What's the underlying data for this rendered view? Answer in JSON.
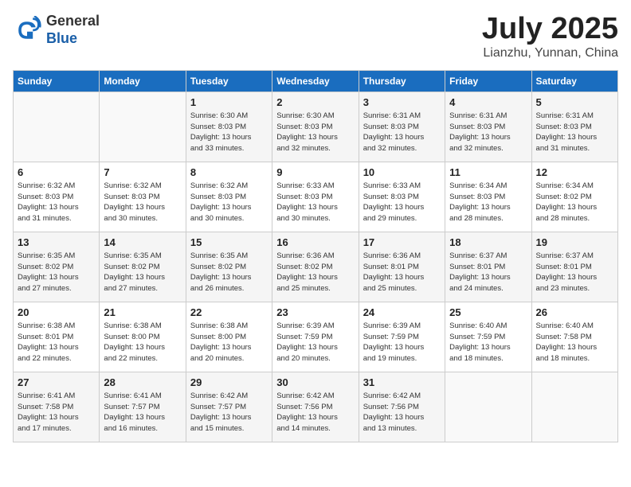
{
  "header": {
    "logo_line1": "General",
    "logo_line2": "Blue",
    "title": "July 2025",
    "subtitle": "Lianzhu, Yunnan, China"
  },
  "weekdays": [
    "Sunday",
    "Monday",
    "Tuesday",
    "Wednesday",
    "Thursday",
    "Friday",
    "Saturday"
  ],
  "weeks": [
    [
      {
        "day": "",
        "info": ""
      },
      {
        "day": "",
        "info": ""
      },
      {
        "day": "1",
        "info": "Sunrise: 6:30 AM\nSunset: 8:03 PM\nDaylight: 13 hours\nand 33 minutes."
      },
      {
        "day": "2",
        "info": "Sunrise: 6:30 AM\nSunset: 8:03 PM\nDaylight: 13 hours\nand 32 minutes."
      },
      {
        "day": "3",
        "info": "Sunrise: 6:31 AM\nSunset: 8:03 PM\nDaylight: 13 hours\nand 32 minutes."
      },
      {
        "day": "4",
        "info": "Sunrise: 6:31 AM\nSunset: 8:03 PM\nDaylight: 13 hours\nand 32 minutes."
      },
      {
        "day": "5",
        "info": "Sunrise: 6:31 AM\nSunset: 8:03 PM\nDaylight: 13 hours\nand 31 minutes."
      }
    ],
    [
      {
        "day": "6",
        "info": "Sunrise: 6:32 AM\nSunset: 8:03 PM\nDaylight: 13 hours\nand 31 minutes."
      },
      {
        "day": "7",
        "info": "Sunrise: 6:32 AM\nSunset: 8:03 PM\nDaylight: 13 hours\nand 30 minutes."
      },
      {
        "day": "8",
        "info": "Sunrise: 6:32 AM\nSunset: 8:03 PM\nDaylight: 13 hours\nand 30 minutes."
      },
      {
        "day": "9",
        "info": "Sunrise: 6:33 AM\nSunset: 8:03 PM\nDaylight: 13 hours\nand 30 minutes."
      },
      {
        "day": "10",
        "info": "Sunrise: 6:33 AM\nSunset: 8:03 PM\nDaylight: 13 hours\nand 29 minutes."
      },
      {
        "day": "11",
        "info": "Sunrise: 6:34 AM\nSunset: 8:03 PM\nDaylight: 13 hours\nand 28 minutes."
      },
      {
        "day": "12",
        "info": "Sunrise: 6:34 AM\nSunset: 8:02 PM\nDaylight: 13 hours\nand 28 minutes."
      }
    ],
    [
      {
        "day": "13",
        "info": "Sunrise: 6:35 AM\nSunset: 8:02 PM\nDaylight: 13 hours\nand 27 minutes."
      },
      {
        "day": "14",
        "info": "Sunrise: 6:35 AM\nSunset: 8:02 PM\nDaylight: 13 hours\nand 27 minutes."
      },
      {
        "day": "15",
        "info": "Sunrise: 6:35 AM\nSunset: 8:02 PM\nDaylight: 13 hours\nand 26 minutes."
      },
      {
        "day": "16",
        "info": "Sunrise: 6:36 AM\nSunset: 8:02 PM\nDaylight: 13 hours\nand 25 minutes."
      },
      {
        "day": "17",
        "info": "Sunrise: 6:36 AM\nSunset: 8:01 PM\nDaylight: 13 hours\nand 25 minutes."
      },
      {
        "day": "18",
        "info": "Sunrise: 6:37 AM\nSunset: 8:01 PM\nDaylight: 13 hours\nand 24 minutes."
      },
      {
        "day": "19",
        "info": "Sunrise: 6:37 AM\nSunset: 8:01 PM\nDaylight: 13 hours\nand 23 minutes."
      }
    ],
    [
      {
        "day": "20",
        "info": "Sunrise: 6:38 AM\nSunset: 8:01 PM\nDaylight: 13 hours\nand 22 minutes."
      },
      {
        "day": "21",
        "info": "Sunrise: 6:38 AM\nSunset: 8:00 PM\nDaylight: 13 hours\nand 22 minutes."
      },
      {
        "day": "22",
        "info": "Sunrise: 6:38 AM\nSunset: 8:00 PM\nDaylight: 13 hours\nand 20 minutes."
      },
      {
        "day": "23",
        "info": "Sunrise: 6:39 AM\nSunset: 7:59 PM\nDaylight: 13 hours\nand 20 minutes."
      },
      {
        "day": "24",
        "info": "Sunrise: 6:39 AM\nSunset: 7:59 PM\nDaylight: 13 hours\nand 19 minutes."
      },
      {
        "day": "25",
        "info": "Sunrise: 6:40 AM\nSunset: 7:59 PM\nDaylight: 13 hours\nand 18 minutes."
      },
      {
        "day": "26",
        "info": "Sunrise: 6:40 AM\nSunset: 7:58 PM\nDaylight: 13 hours\nand 18 minutes."
      }
    ],
    [
      {
        "day": "27",
        "info": "Sunrise: 6:41 AM\nSunset: 7:58 PM\nDaylight: 13 hours\nand 17 minutes."
      },
      {
        "day": "28",
        "info": "Sunrise: 6:41 AM\nSunset: 7:57 PM\nDaylight: 13 hours\nand 16 minutes."
      },
      {
        "day": "29",
        "info": "Sunrise: 6:42 AM\nSunset: 7:57 PM\nDaylight: 13 hours\nand 15 minutes."
      },
      {
        "day": "30",
        "info": "Sunrise: 6:42 AM\nSunset: 7:56 PM\nDaylight: 13 hours\nand 14 minutes."
      },
      {
        "day": "31",
        "info": "Sunrise: 6:42 AM\nSunset: 7:56 PM\nDaylight: 13 hours\nand 13 minutes."
      },
      {
        "day": "",
        "info": ""
      },
      {
        "day": "",
        "info": ""
      }
    ]
  ]
}
